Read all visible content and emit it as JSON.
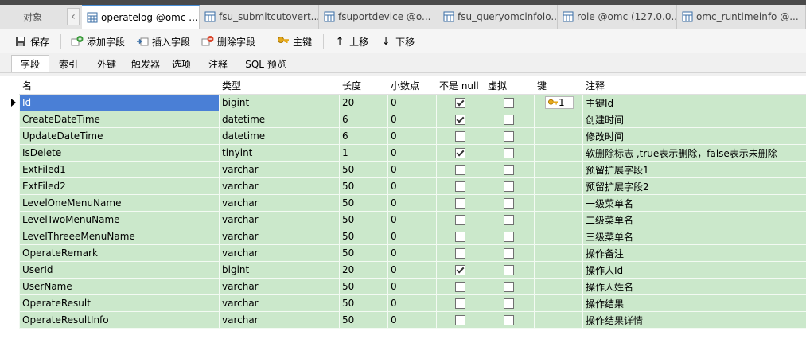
{
  "tabbar": {
    "objects_tab": "对象",
    "tabs": [
      {
        "label": "operatelog @omc ..."
      },
      {
        "label": "fsu_submitcutovert..."
      },
      {
        "label": "fsuportdevice @o..."
      },
      {
        "label": "fsu_queryomcinfolo..."
      },
      {
        "label": "role @omc (127.0.0..."
      },
      {
        "label": "omc_runtimeinfo @..."
      }
    ]
  },
  "toolbar": {
    "save": "保存",
    "add_field": "添加字段",
    "insert_field": "插入字段",
    "delete_field": "删除字段",
    "primary_key": "主键",
    "move_up": "上移",
    "move_down": "下移"
  },
  "subtabs": [
    "字段",
    "索引",
    "外键",
    "触发器",
    "选项",
    "注释",
    "SQL 预览"
  ],
  "grid": {
    "columns": [
      "名",
      "类型",
      "长度",
      "小数点",
      "不是 null",
      "虚拟",
      "键",
      "注释"
    ],
    "rows": [
      {
        "name": "Id",
        "type": "bigint",
        "length": "20",
        "decimals": "0",
        "not_null": true,
        "virtual": false,
        "key": "1",
        "comment": "主键Id"
      },
      {
        "name": "CreateDateTime",
        "type": "datetime",
        "length": "6",
        "decimals": "0",
        "not_null": true,
        "virtual": false,
        "key": "",
        "comment": "创建时间"
      },
      {
        "name": "UpdateDateTime",
        "type": "datetime",
        "length": "6",
        "decimals": "0",
        "not_null": false,
        "virtual": false,
        "key": "",
        "comment": "修改时间"
      },
      {
        "name": "IsDelete",
        "type": "tinyint",
        "length": "1",
        "decimals": "0",
        "not_null": true,
        "virtual": false,
        "key": "",
        "comment": "软删除标志 ,true表示删除，false表示未删除"
      },
      {
        "name": "ExtFiled1",
        "type": "varchar",
        "length": "50",
        "decimals": "0",
        "not_null": false,
        "virtual": false,
        "key": "",
        "comment": "预留扩展字段1"
      },
      {
        "name": "ExtFiled2",
        "type": "varchar",
        "length": "50",
        "decimals": "0",
        "not_null": false,
        "virtual": false,
        "key": "",
        "comment": "预留扩展字段2"
      },
      {
        "name": "LevelOneMenuName",
        "type": "varchar",
        "length": "50",
        "decimals": "0",
        "not_null": false,
        "virtual": false,
        "key": "",
        "comment": "一级菜单名"
      },
      {
        "name": "LevelTwoMenuName",
        "type": "varchar",
        "length": "50",
        "decimals": "0",
        "not_null": false,
        "virtual": false,
        "key": "",
        "comment": "二级菜单名"
      },
      {
        "name": "LevelThreeeMenuName",
        "type": "varchar",
        "length": "50",
        "decimals": "0",
        "not_null": false,
        "virtual": false,
        "key": "",
        "comment": "三级菜单名"
      },
      {
        "name": "OperateRemark",
        "type": "varchar",
        "length": "50",
        "decimals": "0",
        "not_null": false,
        "virtual": false,
        "key": "",
        "comment": "操作备注"
      },
      {
        "name": "UserId",
        "type": "bigint",
        "length": "20",
        "decimals": "0",
        "not_null": true,
        "virtual": false,
        "key": "",
        "comment": "操作人Id"
      },
      {
        "name": "UserName",
        "type": "varchar",
        "length": "50",
        "decimals": "0",
        "not_null": false,
        "virtual": false,
        "key": "",
        "comment": "操作人姓名"
      },
      {
        "name": "OperateResult",
        "type": "varchar",
        "length": "50",
        "decimals": "0",
        "not_null": false,
        "virtual": false,
        "key": "",
        "comment": "操作结果"
      },
      {
        "name": "OperateResultInfo",
        "type": "varchar",
        "length": "50",
        "decimals": "0",
        "not_null": false,
        "virtual": false,
        "key": "",
        "comment": "操作结果详情"
      }
    ]
  }
}
